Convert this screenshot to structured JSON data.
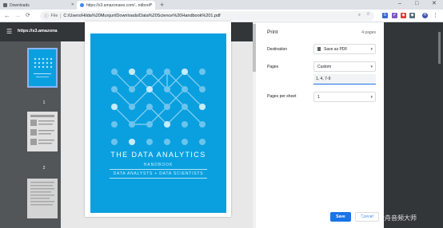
{
  "tabs": [
    {
      "label": "Downloads",
      "active": false,
      "favicon_color": "#5f6368"
    },
    {
      "label": "https://s3.amazonaws.com/...ndbook",
      "active": true,
      "favicon_color": "#4285f4"
    }
  ],
  "window_controls": {
    "minimize": "–",
    "maximize": "□",
    "close": "✕"
  },
  "toolbar": {
    "back": "←",
    "forward": "→",
    "reload": "C",
    "scheme": "File",
    "url": "C:/Users/Hilda%20Munjuri/Downloads/Data%20Science%20Handbook%201.pdf",
    "extensions": [
      {
        "name": "star-icon",
        "glyph": "☆",
        "color": "#5f6368"
      },
      {
        "name": "extension-icon",
        "glyph": "b",
        "color": "#3367d6"
      },
      {
        "name": "extension-icon",
        "glyph": "✔",
        "color": "#7e57c2"
      },
      {
        "name": "extension-icon",
        "glyph": "◆",
        "color": "#e53935"
      },
      {
        "name": "extension-icon",
        "glyph": "◆",
        "color": "#546e7a"
      },
      {
        "name": "avatar",
        "glyph": "H",
        "color": "#3f51b5"
      }
    ]
  },
  "pdf": {
    "title": "https://s3.amazona",
    "thumbnails": [
      "1",
      "2"
    ],
    "cover": {
      "title": "THE DATA ANALYTICS",
      "subtitle": "HANDBOOK",
      "tagline": "DATA ANALYSTS + DATA SCIENTISTS",
      "background": "#0aa0e0"
    }
  },
  "print_dialog": {
    "title": "Print",
    "page_count": "4 pages",
    "destination": {
      "label": "Destination",
      "value": "Save as PDF"
    },
    "pages": {
      "label": "Pages",
      "value": "Custom",
      "input_value": "1, 4, 7-9"
    },
    "pages_per_sheet": {
      "label": "Pages per sheet",
      "value": "1"
    },
    "save_label": "Save",
    "cancel_label": "Cancel",
    "accent_color": "#1a73e8"
  },
  "watermark": "CSDN @金舟音频大师"
}
